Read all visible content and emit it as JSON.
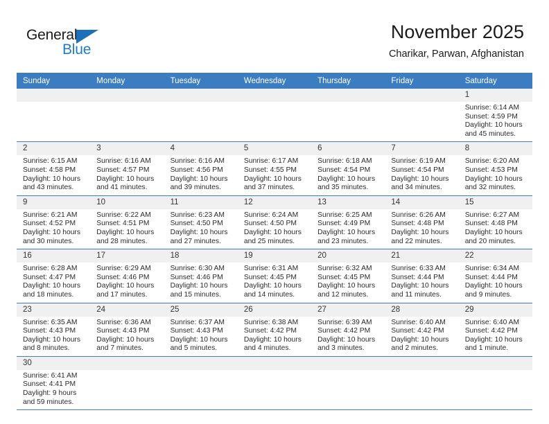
{
  "brand": {
    "name_top": "General",
    "name_bottom": "Blue",
    "triangle_color": "#1d6fb8",
    "blue_color": "#1d7cc4"
  },
  "header": {
    "title": "November 2025",
    "subtitle": "Charikar, Parwan, Afghanistan"
  },
  "theme": {
    "header_bg": "#3b7dc0",
    "daynum_bg": "#f0f0f0",
    "row_border": "#3b7dc0",
    "text": "#2a2a2a"
  },
  "calendar": {
    "weekdays": [
      "Sunday",
      "Monday",
      "Tuesday",
      "Wednesday",
      "Thursday",
      "Friday",
      "Saturday"
    ],
    "weeks": [
      [
        {
          "day": "",
          "sunrise": "",
          "sunset": "",
          "daylight": "",
          "blank": true
        },
        {
          "day": "",
          "sunrise": "",
          "sunset": "",
          "daylight": "",
          "blank": true
        },
        {
          "day": "",
          "sunrise": "",
          "sunset": "",
          "daylight": "",
          "blank": true
        },
        {
          "day": "",
          "sunrise": "",
          "sunset": "",
          "daylight": "",
          "blank": true
        },
        {
          "day": "",
          "sunrise": "",
          "sunset": "",
          "daylight": "",
          "blank": true
        },
        {
          "day": "",
          "sunrise": "",
          "sunset": "",
          "daylight": "",
          "blank": true
        },
        {
          "day": "1",
          "sunrise": "Sunrise: 6:14 AM",
          "sunset": "Sunset: 4:59 PM",
          "daylight": "Daylight: 10 hours and 45 minutes."
        }
      ],
      [
        {
          "day": "2",
          "sunrise": "Sunrise: 6:15 AM",
          "sunset": "Sunset: 4:58 PM",
          "daylight": "Daylight: 10 hours and 43 minutes."
        },
        {
          "day": "3",
          "sunrise": "Sunrise: 6:16 AM",
          "sunset": "Sunset: 4:57 PM",
          "daylight": "Daylight: 10 hours and 41 minutes."
        },
        {
          "day": "4",
          "sunrise": "Sunrise: 6:16 AM",
          "sunset": "Sunset: 4:56 PM",
          "daylight": "Daylight: 10 hours and 39 minutes."
        },
        {
          "day": "5",
          "sunrise": "Sunrise: 6:17 AM",
          "sunset": "Sunset: 4:55 PM",
          "daylight": "Daylight: 10 hours and 37 minutes."
        },
        {
          "day": "6",
          "sunrise": "Sunrise: 6:18 AM",
          "sunset": "Sunset: 4:54 PM",
          "daylight": "Daylight: 10 hours and 35 minutes."
        },
        {
          "day": "7",
          "sunrise": "Sunrise: 6:19 AM",
          "sunset": "Sunset: 4:54 PM",
          "daylight": "Daylight: 10 hours and 34 minutes."
        },
        {
          "day": "8",
          "sunrise": "Sunrise: 6:20 AM",
          "sunset": "Sunset: 4:53 PM",
          "daylight": "Daylight: 10 hours and 32 minutes."
        }
      ],
      [
        {
          "day": "9",
          "sunrise": "Sunrise: 6:21 AM",
          "sunset": "Sunset: 4:52 PM",
          "daylight": "Daylight: 10 hours and 30 minutes."
        },
        {
          "day": "10",
          "sunrise": "Sunrise: 6:22 AM",
          "sunset": "Sunset: 4:51 PM",
          "daylight": "Daylight: 10 hours and 28 minutes."
        },
        {
          "day": "11",
          "sunrise": "Sunrise: 6:23 AM",
          "sunset": "Sunset: 4:50 PM",
          "daylight": "Daylight: 10 hours and 27 minutes."
        },
        {
          "day": "12",
          "sunrise": "Sunrise: 6:24 AM",
          "sunset": "Sunset: 4:50 PM",
          "daylight": "Daylight: 10 hours and 25 minutes."
        },
        {
          "day": "13",
          "sunrise": "Sunrise: 6:25 AM",
          "sunset": "Sunset: 4:49 PM",
          "daylight": "Daylight: 10 hours and 23 minutes."
        },
        {
          "day": "14",
          "sunrise": "Sunrise: 6:26 AM",
          "sunset": "Sunset: 4:48 PM",
          "daylight": "Daylight: 10 hours and 22 minutes."
        },
        {
          "day": "15",
          "sunrise": "Sunrise: 6:27 AM",
          "sunset": "Sunset: 4:48 PM",
          "daylight": "Daylight: 10 hours and 20 minutes."
        }
      ],
      [
        {
          "day": "16",
          "sunrise": "Sunrise: 6:28 AM",
          "sunset": "Sunset: 4:47 PM",
          "daylight": "Daylight: 10 hours and 18 minutes."
        },
        {
          "day": "17",
          "sunrise": "Sunrise: 6:29 AM",
          "sunset": "Sunset: 4:46 PM",
          "daylight": "Daylight: 10 hours and 17 minutes."
        },
        {
          "day": "18",
          "sunrise": "Sunrise: 6:30 AM",
          "sunset": "Sunset: 4:46 PM",
          "daylight": "Daylight: 10 hours and 15 minutes."
        },
        {
          "day": "19",
          "sunrise": "Sunrise: 6:31 AM",
          "sunset": "Sunset: 4:45 PM",
          "daylight": "Daylight: 10 hours and 14 minutes."
        },
        {
          "day": "20",
          "sunrise": "Sunrise: 6:32 AM",
          "sunset": "Sunset: 4:45 PM",
          "daylight": "Daylight: 10 hours and 12 minutes."
        },
        {
          "day": "21",
          "sunrise": "Sunrise: 6:33 AM",
          "sunset": "Sunset: 4:44 PM",
          "daylight": "Daylight: 10 hours and 11 minutes."
        },
        {
          "day": "22",
          "sunrise": "Sunrise: 6:34 AM",
          "sunset": "Sunset: 4:44 PM",
          "daylight": "Daylight: 10 hours and 9 minutes."
        }
      ],
      [
        {
          "day": "23",
          "sunrise": "Sunrise: 6:35 AM",
          "sunset": "Sunset: 4:43 PM",
          "daylight": "Daylight: 10 hours and 8 minutes."
        },
        {
          "day": "24",
          "sunrise": "Sunrise: 6:36 AM",
          "sunset": "Sunset: 4:43 PM",
          "daylight": "Daylight: 10 hours and 7 minutes."
        },
        {
          "day": "25",
          "sunrise": "Sunrise: 6:37 AM",
          "sunset": "Sunset: 4:43 PM",
          "daylight": "Daylight: 10 hours and 5 minutes."
        },
        {
          "day": "26",
          "sunrise": "Sunrise: 6:38 AM",
          "sunset": "Sunset: 4:42 PM",
          "daylight": "Daylight: 10 hours and 4 minutes."
        },
        {
          "day": "27",
          "sunrise": "Sunrise: 6:39 AM",
          "sunset": "Sunset: 4:42 PM",
          "daylight": "Daylight: 10 hours and 3 minutes."
        },
        {
          "day": "28",
          "sunrise": "Sunrise: 6:40 AM",
          "sunset": "Sunset: 4:42 PM",
          "daylight": "Daylight: 10 hours and 2 minutes."
        },
        {
          "day": "29",
          "sunrise": "Sunrise: 6:40 AM",
          "sunset": "Sunset: 4:42 PM",
          "daylight": "Daylight: 10 hours and 1 minute."
        }
      ],
      [
        {
          "day": "30",
          "sunrise": "Sunrise: 6:41 AM",
          "sunset": "Sunset: 4:41 PM",
          "daylight": "Daylight: 9 hours and 59 minutes."
        },
        {
          "day": "",
          "sunrise": "",
          "sunset": "",
          "daylight": "",
          "blank": true
        },
        {
          "day": "",
          "sunrise": "",
          "sunset": "",
          "daylight": "",
          "blank": true
        },
        {
          "day": "",
          "sunrise": "",
          "sunset": "",
          "daylight": "",
          "blank": true
        },
        {
          "day": "",
          "sunrise": "",
          "sunset": "",
          "daylight": "",
          "blank": true
        },
        {
          "day": "",
          "sunrise": "",
          "sunset": "",
          "daylight": "",
          "blank": true
        },
        {
          "day": "",
          "sunrise": "",
          "sunset": "",
          "daylight": "",
          "blank": true
        }
      ]
    ]
  }
}
